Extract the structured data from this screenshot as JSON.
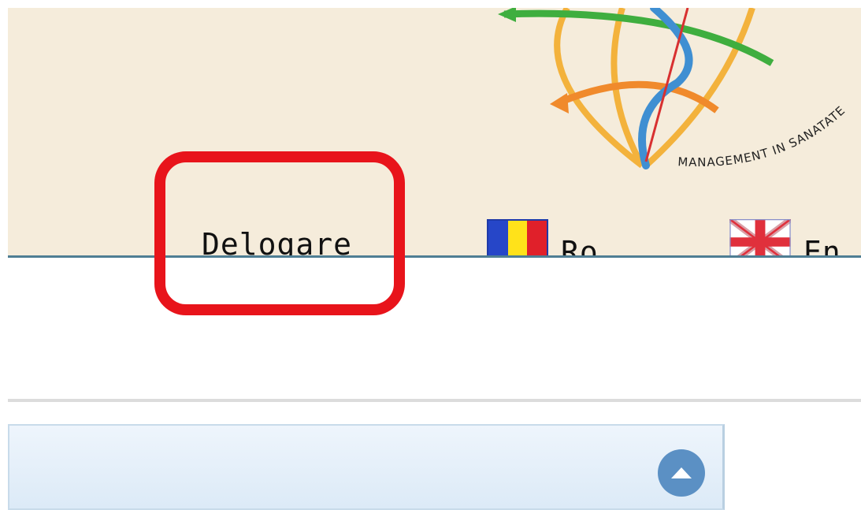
{
  "header": {
    "logo_caption": "MANAGEMENT IN SANATATE",
    "logout_label": "Delogare",
    "languages": [
      {
        "code": "ro",
        "label": "Ro",
        "flag": "romania-flag-icon"
      },
      {
        "code": "en",
        "label": "En",
        "flag": "uk-flag-icon"
      }
    ]
  },
  "panel": {
    "collapse_icon": "chevron-up-icon"
  },
  "colors": {
    "header_bg": "#f5ecdb",
    "header_rule": "#4f7e94",
    "highlight": "#e8141b",
    "panel_button": "#5b90c4"
  }
}
